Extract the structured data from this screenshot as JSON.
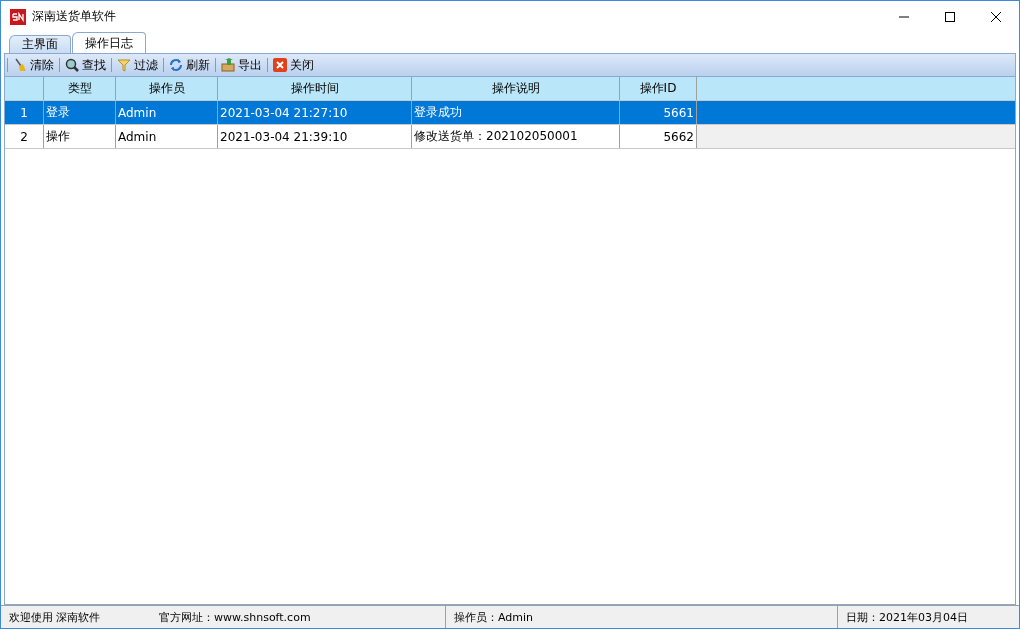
{
  "window": {
    "title": "深南送货单软件"
  },
  "tabs": [
    {
      "label": "主界面",
      "selected": false
    },
    {
      "label": "操作日志",
      "selected": true
    }
  ],
  "toolbar": [
    {
      "label": "清除"
    },
    {
      "label": "查找"
    },
    {
      "label": "过滤"
    },
    {
      "label": "刷新"
    },
    {
      "label": "导出"
    },
    {
      "label": "关闭"
    }
  ],
  "table": {
    "columns": [
      "类型",
      "操作员",
      "操作时间",
      "操作说明",
      "操作ID"
    ],
    "rows": [
      {
        "index": "1",
        "cells": [
          "登录",
          "Admin",
          "2021-03-04 21:27:10",
          "登录成功",
          "5661"
        ],
        "selected": true
      },
      {
        "index": "2",
        "cells": [
          "操作",
          "Admin",
          "2021-03-04 21:39:10",
          "修改送货单：202102050001",
          "5662"
        ],
        "selected": false
      }
    ]
  },
  "status_bar": [
    "欢迎使用 深南软件",
    "官方网址：www.shnsoft.com",
    "操作员：Admin",
    "日期：2021年03月04日"
  ]
}
